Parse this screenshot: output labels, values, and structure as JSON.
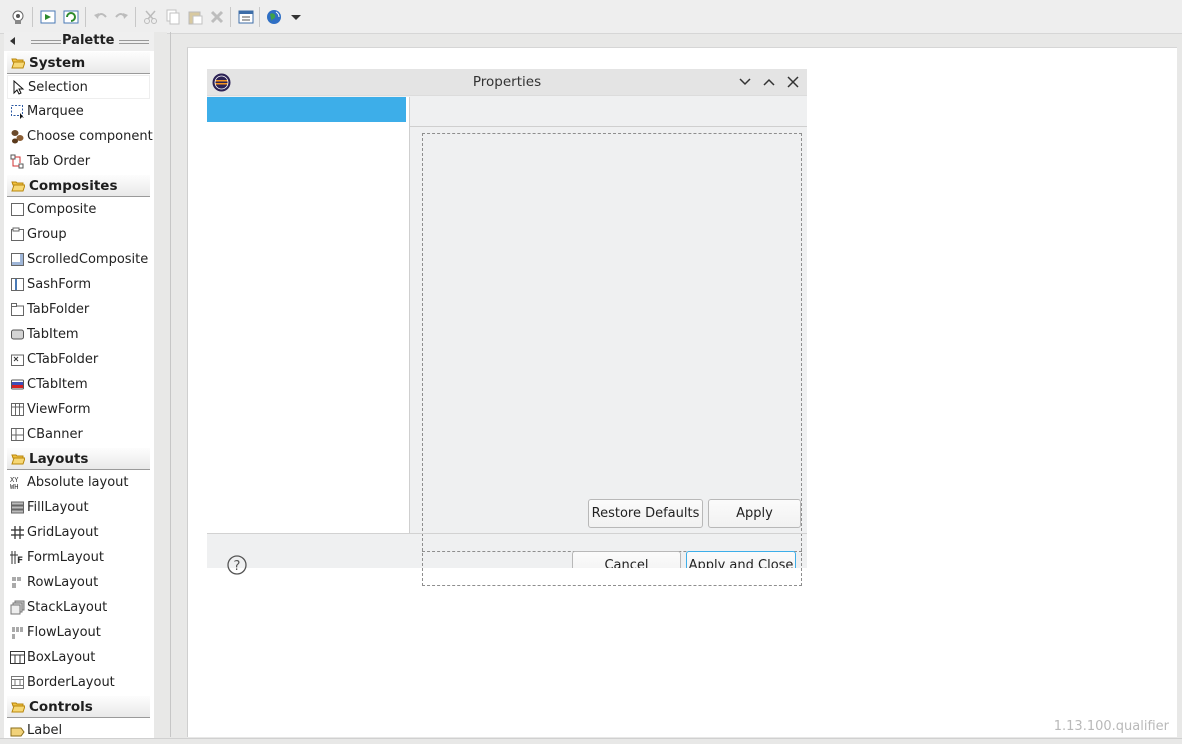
{
  "toolbar": {
    "buttons": [
      "design-icon",
      "bean-add-icon",
      "refresh-icon",
      "undo-icon",
      "redo-icon",
      "cut-icon",
      "copy-icon",
      "paste-icon",
      "delete-icon",
      "properties-icon",
      "globe-icon",
      "dropdown-arrow-icon"
    ]
  },
  "palette": {
    "title": "Palette",
    "groups": [
      {
        "label": "System",
        "items": [
          "Selection",
          "Marquee",
          "Choose component",
          "Tab Order"
        ]
      },
      {
        "label": "Composites",
        "items": [
          "Composite",
          "Group",
          "ScrolledComposite",
          "SashForm",
          "TabFolder",
          "TabItem",
          "CTabFolder",
          "CTabItem",
          "ViewForm",
          "CBanner"
        ]
      },
      {
        "label": "Layouts",
        "items": [
          "Absolute layout",
          "FillLayout",
          "GridLayout",
          "FormLayout",
          "RowLayout",
          "StackLayout",
          "FlowLayout",
          "BoxLayout",
          "BorderLayout"
        ]
      },
      {
        "label": "Controls",
        "items": [
          "Label"
        ]
      }
    ]
  },
  "dialog": {
    "title": "Properties",
    "buttons": {
      "restore_defaults": "Restore Defaults",
      "apply": "Apply",
      "cancel": "Cancel",
      "apply_and_close": "Apply and Close"
    }
  },
  "canvas": {
    "version": "1.13.100.qualifier"
  },
  "colors": {
    "selection_blue": "#3daee9",
    "dialog_bg": "#eff0f1"
  }
}
